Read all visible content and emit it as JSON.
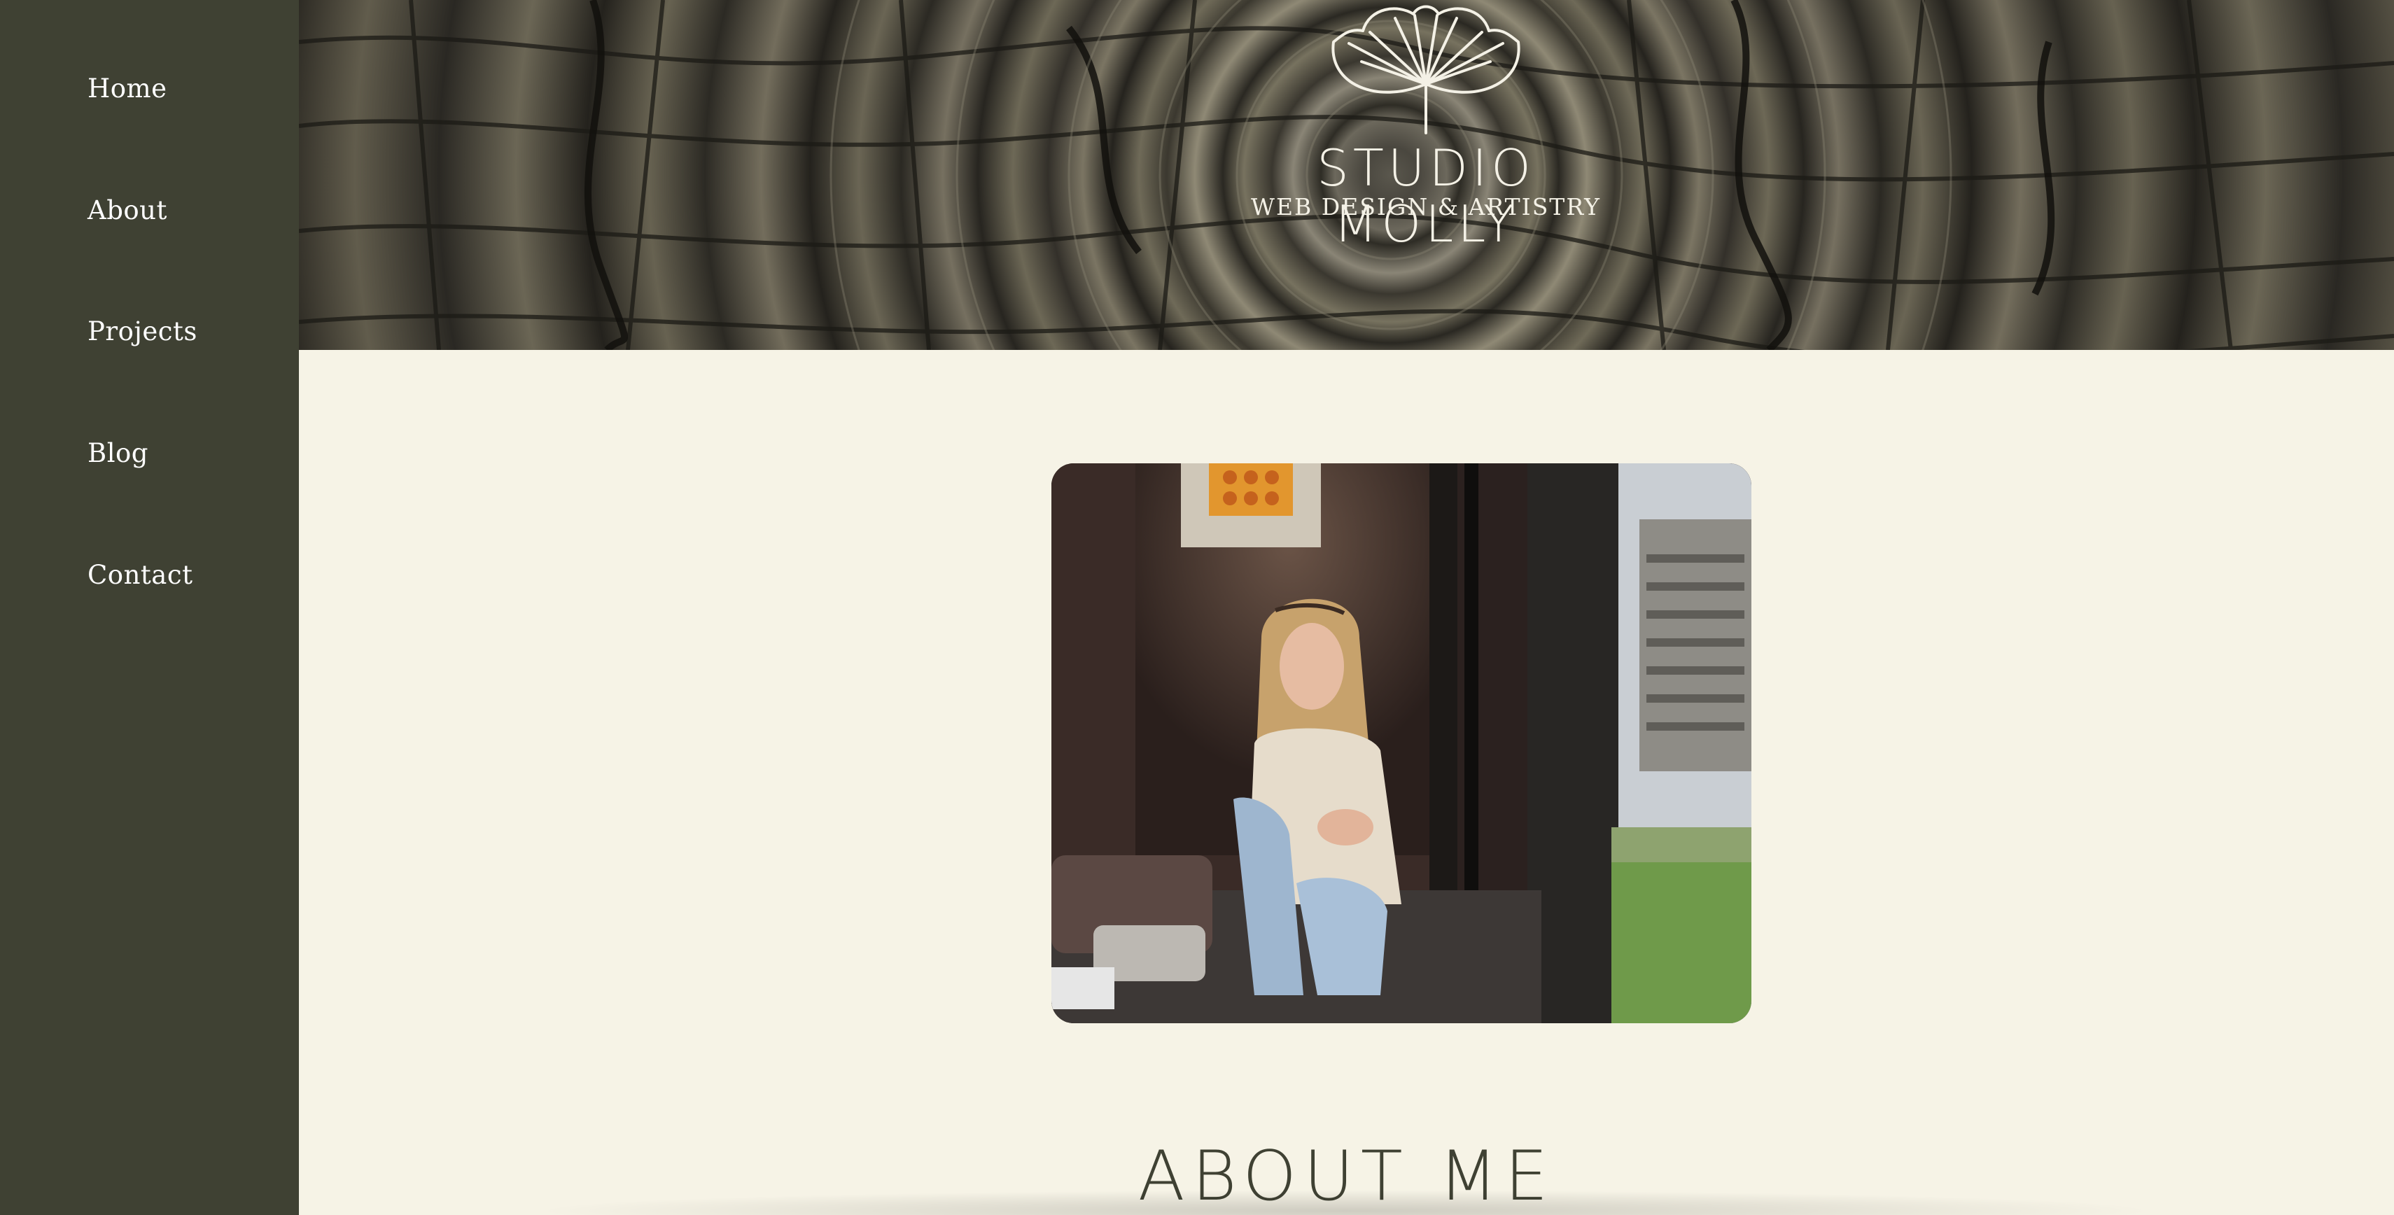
{
  "sidebar": {
    "items": [
      {
        "label": "Home"
      },
      {
        "label": "About"
      },
      {
        "label": "Projects"
      },
      {
        "label": "Blog"
      },
      {
        "label": "Contact"
      }
    ]
  },
  "header": {
    "logo_title": "STUDIO MOLLY",
    "logo_subtitle": "WEB DESIGN & ARTISTRY",
    "logo_icon": "ginkgo-leaf-icon"
  },
  "main": {
    "section_title": "ABOUT ME",
    "photo_icon": "profile-photo"
  },
  "colors": {
    "sidebar": "#3f4133",
    "content_bg": "#f6f3e6",
    "heading": "#3f4133",
    "logo": "#f4f1e6"
  }
}
